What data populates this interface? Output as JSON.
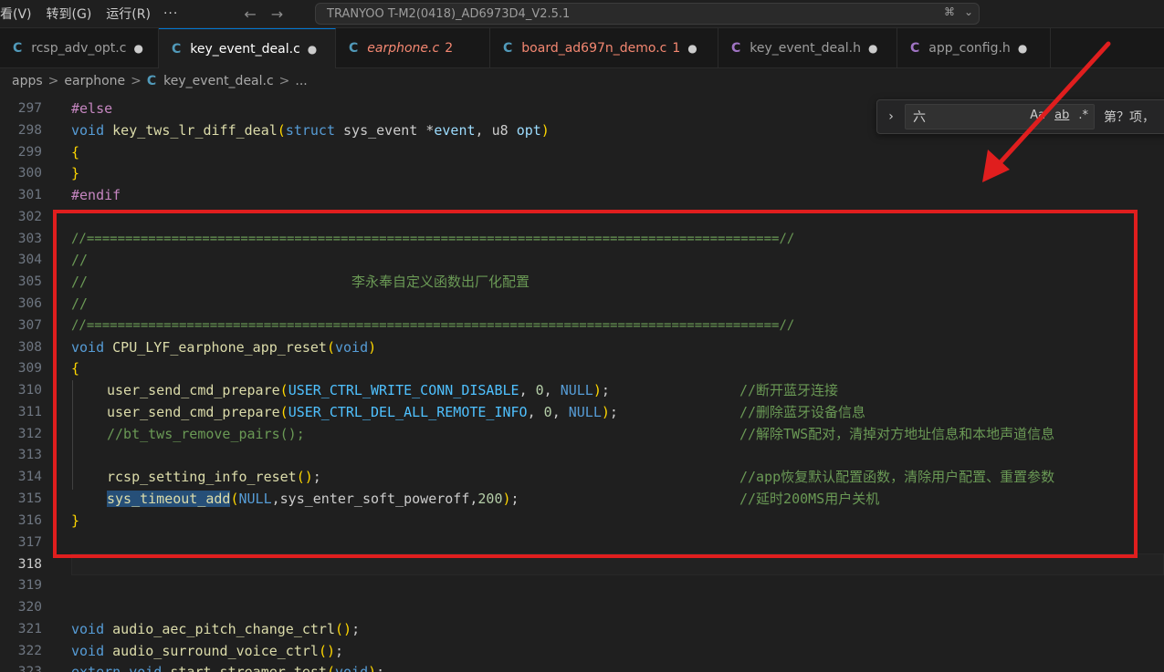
{
  "menu": {
    "items": [
      "看(V)",
      "转到(G)",
      "运行(R)"
    ],
    "more": "···"
  },
  "nav": {
    "back": "←",
    "forward": "→"
  },
  "command_center": {
    "title": "TRANYOO T-M2(0418)_AD6973D4_V2.5.1",
    "chat": "⌘",
    "dropdown": "⌄"
  },
  "tabs": [
    {
      "icon": "C",
      "label": "rcsp_adv_opt.c",
      "dot": "●",
      "errors": ""
    },
    {
      "icon": "C",
      "label": "key_event_deal.c",
      "dot": "●",
      "errors": ""
    },
    {
      "icon": "C",
      "label": "earphone.c",
      "dot": "",
      "errors": "2"
    },
    {
      "icon": "C",
      "label": "board_ad697n_demo.c",
      "dot": "●",
      "errors": "1"
    },
    {
      "icon": "C",
      "label": "key_event_deal.h",
      "dot": "●",
      "errors": ""
    },
    {
      "icon": "C",
      "label": "app_config.h",
      "dot": "●",
      "errors": ""
    }
  ],
  "breadcrumb": {
    "parts": [
      "apps",
      "earphone",
      "key_event_deal.c",
      "..."
    ],
    "file_icon": "C",
    "sep": ">"
  },
  "find": {
    "query": "六",
    "toggle": "›",
    "opt_case": "Aa",
    "opt_word": "ab",
    "opt_regex": ".*",
    "count": "第？项，"
  },
  "code": {
    "l297": {
      "n": "297",
      "t": "#else"
    },
    "l298": {
      "n": "298",
      "kw1": "void",
      "fn": "key_tws_lr_diff_deal",
      "p1": "(",
      "kw2": "struct",
      "t1": " sys_event *",
      "v1": "event",
      "t2": ", u8 ",
      "v2": "opt",
      "p2": ")"
    },
    "l299": {
      "n": "299",
      "t": "{"
    },
    "l300": {
      "n": "300",
      "t": "}"
    },
    "l301": {
      "n": "301",
      "t": "#endif"
    },
    "l302": {
      "n": "302"
    },
    "l303": {
      "n": "303",
      "t": "//==========================================================================================//"
    },
    "l304": {
      "n": "304",
      "t": "//"
    },
    "l305": {
      "n": "305",
      "t": "//                                李永奉自定义函数出厂化配置"
    },
    "l306": {
      "n": "306",
      "t": "//"
    },
    "l307": {
      "n": "307",
      "t": "//==========================================================================================//"
    },
    "l308": {
      "n": "308",
      "kw1": "void",
      "fn": "CPU_LYF_earphone_app_reset",
      "p1": "(",
      "kw2": "void",
      "p2": ")"
    },
    "l309": {
      "n": "309",
      "t": "{"
    },
    "l310": {
      "n": "310",
      "fn": "user_send_cmd_prepare",
      "p1": "(",
      "c1": "USER_CTRL_WRITE_CONN_DISABLE",
      "t1": ", ",
      "num": "0",
      "t2": ", ",
      "c2": "NULL",
      "p2": ")",
      "t3": ";",
      "cmt": "//断开蓝牙连接"
    },
    "l311": {
      "n": "311",
      "fn": "user_send_cmd_prepare",
      "p1": "(",
      "c1": "USER_CTRL_DEL_ALL_REMOTE_INFO",
      "t1": ", ",
      "num": "0",
      "t2": ", ",
      "c2": "NULL",
      "p2": ")",
      "t3": ";",
      "cmt": "//删除蓝牙设备信息"
    },
    "l312": {
      "n": "312",
      "t": "//bt_tws_remove_pairs();",
      "cmt": "//解除TWS配对，清掉对方地址信息和本地声道信息"
    },
    "l313": {
      "n": "313"
    },
    "l314": {
      "n": "314",
      "fn": "rcsp_setting_info_reset",
      "p": "()",
      "t": ";",
      "cmt": "//app恢复默认配置函数，清除用户配置、重置参数"
    },
    "l315": {
      "n": "315",
      "fn": "sys_timeout_add",
      "p1": "(",
      "c1": "NULL",
      "t1": ",sys_enter_soft_poweroff,",
      "num": "200",
      "p2": ")",
      "t2": ";",
      "cmt": "//延时200MS用户关机"
    },
    "l316": {
      "n": "316",
      "t": "}"
    },
    "l317": {
      "n": "317"
    },
    "l318": {
      "n": "318"
    },
    "l319": {
      "n": "319"
    },
    "l320": {
      "n": "320"
    },
    "l321": {
      "n": "321",
      "kw": "void",
      "fn": "audio_aec_pitch_change_ctrl",
      "p": "()",
      "t": ";"
    },
    "l322": {
      "n": "322",
      "kw": "void",
      "fn": "audio_surround_voice_ctrl",
      "p": "()",
      "t": ";"
    },
    "l323": {
      "n": "323",
      "kw1": "extern",
      "kw2": "void",
      "fn": "start_streamer_test",
      "p1": "(",
      "kw3": "void",
      "p2": ")",
      "t": ";"
    }
  },
  "colors": {
    "annotation": "#e01e1e",
    "accent": "#0078d4",
    "warning": "#f48771"
  }
}
